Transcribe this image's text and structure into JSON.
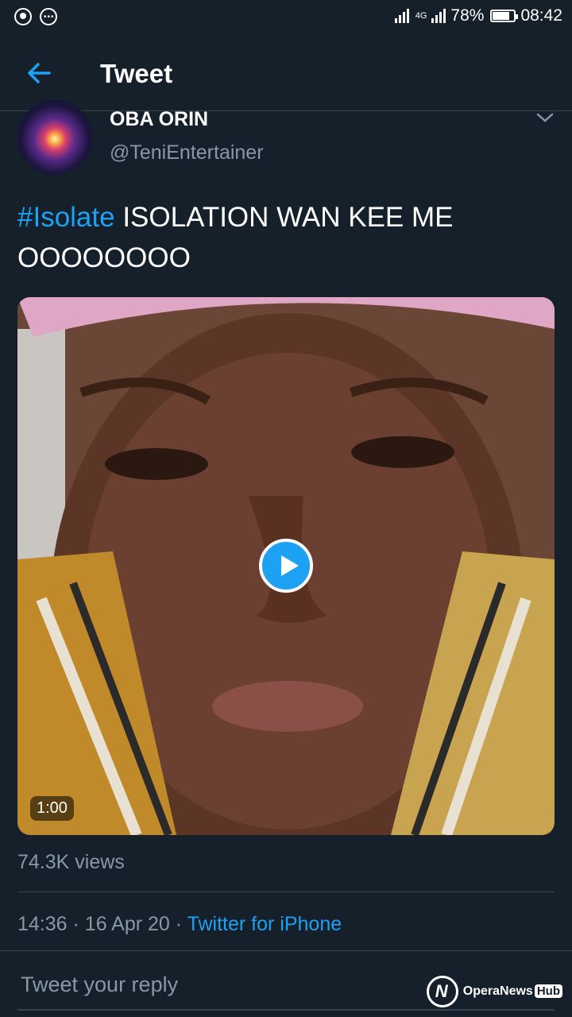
{
  "status_bar": {
    "icons": [
      "whatsapp-icon",
      "more-icon",
      "signal-icon",
      "signal-icon"
    ],
    "network": "4G",
    "battery": "78%",
    "battery_level": 0.78,
    "time": "08:42"
  },
  "header": {
    "title": "Tweet"
  },
  "tweet": {
    "author_name": "OBA ORIN",
    "author_handle": "@TeniEntertainer",
    "hashtag": "#Isolate",
    "text": " ISOLATION WAN KEE ME OOOOOOOO",
    "video_duration": "1:00",
    "views": "74.3K views",
    "time": "14:36",
    "date": "16 Apr 20",
    "separator": "·",
    "source": "Twitter for iPhone"
  },
  "reply": {
    "placeholder": "Tweet your reply"
  },
  "watermark": {
    "text": "OperaNews",
    "badge": "Hub"
  },
  "colors": {
    "background": "#15202b",
    "accent": "#1da1f2",
    "muted": "#8899a6",
    "divider": "#38444d"
  }
}
